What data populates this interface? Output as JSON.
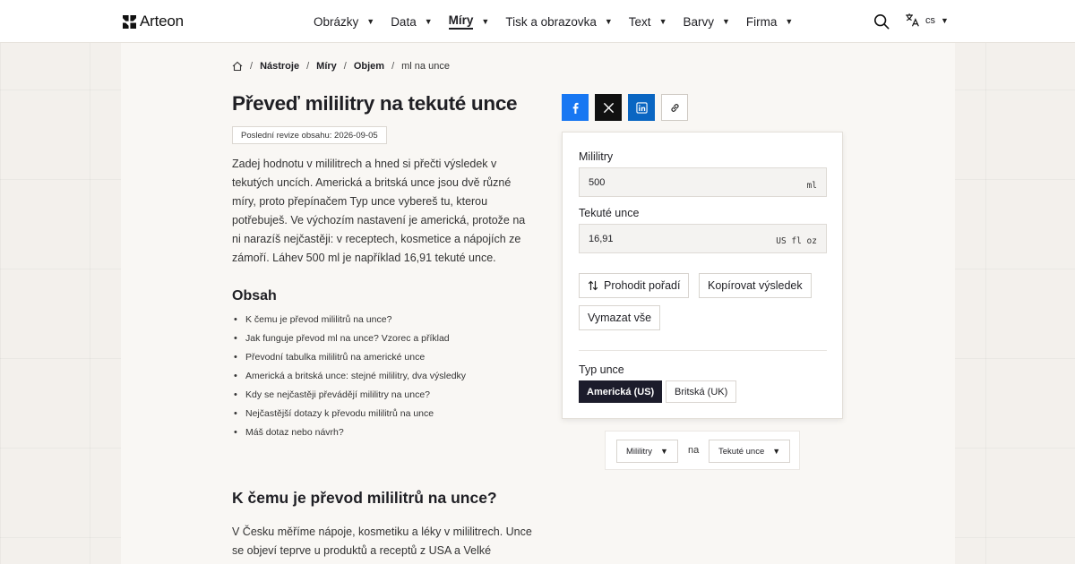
{
  "header": {
    "brand": "Arteon",
    "nav": [
      {
        "label": "Obrázky",
        "active": false
      },
      {
        "label": "Data",
        "active": false
      },
      {
        "label": "Míry",
        "active": true
      },
      {
        "label": "Tisk a obrazovka",
        "active": false
      },
      {
        "label": "Text",
        "active": false
      },
      {
        "label": "Barvy",
        "active": false
      },
      {
        "label": "Firma",
        "active": false
      }
    ],
    "language": "cs",
    "icons": [
      "search-icon",
      "translate-icon",
      "chevron-down-icon"
    ]
  },
  "breadcrumb": {
    "items": [
      "Nástroje",
      "Míry",
      "Objem"
    ],
    "current": "ml na unce",
    "separator": "/"
  },
  "page": {
    "title": "Převeď mililitry na tekuté unce",
    "revision": "Poslední revize obsahu: 2026-09-05",
    "intro": "Zadej hodnotu v mililitrech a hned si přečti výsledek v tekutých uncích. Americká a britská unce jsou dvě různé míry, proto přepínačem Typ unce vybereš tu, kterou potřebuješ. Ve výchozím nastavení je americká, protože na ni narazíš nejčastěji: v receptech, kosmetice a nápojích ze zámoří. Láhev 500 ml je například 16,91 tekuté unce.",
    "toc_title": "Obsah",
    "toc": [
      "K čemu je převod mililitrů na unce?",
      "Jak funguje převod ml na unce? Vzorec a příklad",
      "Převodní tabulka mililitrů na americké unce",
      "Americká a britská unce: stejné mililitry, dva výsledky",
      "Kdy se nejčastěji převádějí mililitry na unce?",
      "Nejčastější dotazy k převodu mililitrů na unce",
      "Máš dotaz nebo návrh?"
    ],
    "section_title": "K čemu je převod mililitrů na unce?",
    "section_text": "V Česku měříme nápoje, kosmetiku a léky v mililitrech. Unce se objeví teprve u produktů a receptů z USA a Velké"
  },
  "share": {
    "buttons": [
      "facebook-icon",
      "x-icon",
      "linkedin-icon",
      "link-icon"
    ],
    "colors": {
      "facebook": "#1877f2",
      "x": "#111111",
      "linkedin": "#0a66c2"
    }
  },
  "converter": {
    "from_label": "Mililitry",
    "from_value": "500",
    "from_unit": "ml",
    "to_label": "Tekuté unce",
    "to_value": "16,91",
    "to_unit": "US fl oz",
    "swap_button": "Prohodit pořadí",
    "copy_button": "Kopírovat výsledek",
    "clear_button": "Vymazat vše",
    "type_label": "Typ unce",
    "type_options": [
      "Americká (US)",
      "Britská (UK)"
    ],
    "type_selected": "Americká (US)"
  },
  "switcher": {
    "from": "Mililitry",
    "connector": "na",
    "to": "Tekuté unce"
  },
  "colors": {
    "accent_dark": "#1c1c2b",
    "page_bg": "#f3f0ec",
    "panel_bg": "#f9f7f4"
  }
}
